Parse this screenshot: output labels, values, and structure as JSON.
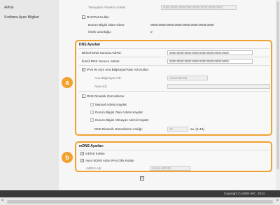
{
  "sidebar": {
    "items": [
      {
        "label": "AirKai"
      },
      {
        "label": "Sınifama Ayarı Bilgileri"
      }
    ]
  },
  "top": {
    "manager_address_label": "Yanayidan Yöneticı Adresi",
    "manager_address_value": "0000:0000:0000:0000:0000:0000:0000:0000",
    "dhcpv6_label": "DHCPv6 Kullan",
    "state_label": "Durum Bilgisi Olan Adres:",
    "state_value": "0000:0000:0000:0000:0000:0000:0000:0000",
    "prefix_label": "Önek Uzunluğu:",
    "prefix_value": "0"
  },
  "dns": {
    "title": "DNS Ayarları",
    "primary_label": "Birincil DNS Sunucu Adresi:",
    "primary_value": "0000:0000:0000:0000:0000:0000:0000:0000",
    "secondary_label": "İkincil DNS Sunucu Adresi:",
    "secondary_value": "0000:0000:0000:0000:0000:0000:0000:0000",
    "same_host_label": "IPv4 ile Aynı Ana Bilgisayar/Alan Adı Kullan",
    "host_label": "Ana Bilgisayar Adı:",
    "host_value": "Canon08c5f1",
    "domain_label": "Alan Adı:",
    "domain_value": "",
    "dynamic_label": "DNS Dinamik Güncelleme",
    "manual_label": "Manuel Adresi Kaydet",
    "stateful_label": "Durum Bilgisi Olan Adresi Kaydet",
    "stateless_label": "Durum Bilgisi Olmayan Adresi Kaydet",
    "interval_label": "DNS Dinamik Güncelleme Aralığı:",
    "interval_value": "24",
    "interval_unit": "sa. (0-48)"
  },
  "mdns": {
    "title": "mDNS Ayarları",
    "use_label": "mDNS Kullan",
    "same_name_label": "Aynı mDNS Adını IPv4 Olık Kullan",
    "name_label": "mDNS Adı:",
    "name_value": "Canon MF525"
  },
  "badges": {
    "a": "a",
    "b": "b"
  },
  "footer": {
    "copyright": "Copyright CANON INC. 2014"
  }
}
